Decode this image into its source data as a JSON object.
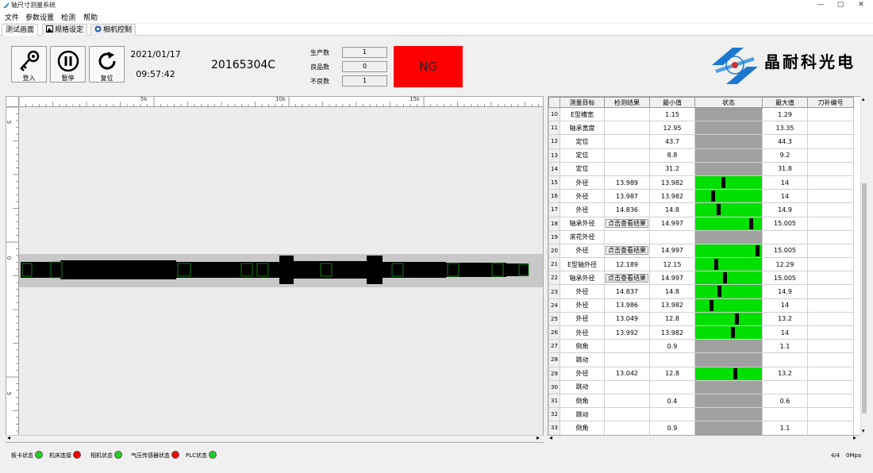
{
  "app": {
    "title": "轴尺寸测量系统",
    "window_buttons": {
      "minimize": "—",
      "maximize": "▢",
      "close": "✕"
    }
  },
  "menu": [
    "文件",
    "参数设置",
    "检测",
    "帮助"
  ],
  "tabs": [
    {
      "label": "测试画面",
      "active": true
    },
    {
      "label": "规格设定",
      "active": false,
      "icon": "image-icon"
    },
    {
      "label": "相机控制",
      "active": false,
      "icon": "camera-icon"
    }
  ],
  "toolbar": {
    "login_label": "登入",
    "pause_label": "暂停",
    "reset_label": "复位",
    "date": "2021/01/17",
    "time": "09:57:42",
    "part_code": "20165304C",
    "counters": [
      {
        "label": "生产数",
        "value": "1"
      },
      {
        "label": "良品数",
        "value": "0"
      },
      {
        "label": "不良数",
        "value": "1"
      }
    ],
    "result": "NG",
    "result_color": "#ff0000",
    "brand": "晶耐科光电"
  },
  "ruler": {
    "h_labels": [
      "5k",
      "10k",
      "15k"
    ],
    "v_labels": [
      "5",
      "0",
      "5"
    ]
  },
  "table": {
    "headers": [
      "测量目标",
      "检测结果",
      "最小值",
      "状态",
      "最大值",
      "刀补编号"
    ],
    "rows": [
      {
        "idx": "10",
        "target": "E型槽宽",
        "result": "",
        "min": "1.15",
        "status": "gray",
        "max": "1.29"
      },
      {
        "idx": "11",
        "target": "轴承宽度",
        "result": "",
        "min": "12.95",
        "status": "gray",
        "max": "13.35"
      },
      {
        "idx": "12",
        "target": "定位",
        "result": "",
        "min": "43.7",
        "status": "gray",
        "max": "44.3"
      },
      {
        "idx": "13",
        "target": "定位",
        "result": "",
        "min": "8.8",
        "status": "gray",
        "max": "9.2"
      },
      {
        "idx": "14",
        "target": "定位",
        "result": "",
        "min": "31.2",
        "status": "gray",
        "max": "31.8"
      },
      {
        "idx": "15",
        "target": "外径",
        "result": "13.989",
        "min": "13.982",
        "status": "green",
        "marker": 0.41,
        "max": "14"
      },
      {
        "idx": "16",
        "target": "外径",
        "result": "13.987",
        "min": "13.982",
        "status": "green",
        "marker": 0.25,
        "max": "14"
      },
      {
        "idx": "17",
        "target": "外径",
        "result": "14.836",
        "min": "14.8",
        "status": "green",
        "marker": 0.34,
        "max": "14.9"
      },
      {
        "idx": "18",
        "target": "轴承外径",
        "result": "点击查看结果",
        "result_button": true,
        "min": "14.997",
        "status": "green",
        "marker": 0.85,
        "max": "15.005"
      },
      {
        "idx": "19",
        "target": "滚花外径",
        "result": "",
        "min": "",
        "status": "gray",
        "max": ""
      },
      {
        "idx": "20",
        "target": "外径",
        "result": "点击查看结果",
        "result_button": true,
        "min": "14.997",
        "status": "green",
        "marker": 0.95,
        "max": "15.005"
      },
      {
        "idx": "21",
        "target": "E型轴外径",
        "result": "12.189",
        "min": "12.15",
        "status": "green",
        "marker": 0.3,
        "max": "12.29"
      },
      {
        "idx": "22",
        "target": "轴承外径",
        "result": "点击查看结果",
        "result_button": true,
        "min": "14.997",
        "status": "green",
        "marker": 0.44,
        "max": "15.005"
      },
      {
        "idx": "23",
        "target": "外径",
        "result": "14.837",
        "min": "14.8",
        "status": "green",
        "marker": 0.35,
        "max": "14.9"
      },
      {
        "idx": "24",
        "target": "外径",
        "result": "13.986",
        "min": "13.982",
        "status": "green",
        "marker": 0.22,
        "max": "14"
      },
      {
        "idx": "25",
        "target": "外径",
        "result": "13.049",
        "min": "12.8",
        "status": "green",
        "marker": 0.62,
        "max": "13.2"
      },
      {
        "idx": "26",
        "target": "外径",
        "result": "13.992",
        "min": "13.982",
        "status": "green",
        "marker": 0.56,
        "max": "14"
      },
      {
        "idx": "27",
        "target": "倒角",
        "result": "",
        "min": "0.9",
        "status": "gray",
        "max": "1.1"
      },
      {
        "idx": "28",
        "target": "跳动",
        "result": "",
        "min": "",
        "status": "gray",
        "max": ""
      },
      {
        "idx": "29",
        "target": "外径",
        "result": "13.042",
        "min": "12.8",
        "status": "green",
        "marker": 0.6,
        "max": "13.2"
      },
      {
        "idx": "30",
        "target": "跳动",
        "result": "",
        "min": "",
        "status": "gray",
        "max": ""
      },
      {
        "idx": "31",
        "target": "倒角",
        "result": "",
        "min": "0.4",
        "status": "gray",
        "max": "0.6"
      },
      {
        "idx": "32",
        "target": "跳动",
        "result": "",
        "min": "",
        "status": "gray",
        "max": ""
      },
      {
        "idx": "33",
        "target": "倒角",
        "result": "",
        "min": "0.9",
        "status": "gray",
        "max": "1.1"
      }
    ]
  },
  "status_bar": {
    "items": [
      {
        "label": "板卡状态",
        "color": "#20d020"
      },
      {
        "label": "机床连接",
        "color": "#ff0000"
      },
      {
        "label": "相机状态",
        "color": "#20d020"
      },
      {
        "label": "气压传感器状态",
        "color": "#ff0000"
      },
      {
        "label": "PLC状态",
        "color": "#20d020"
      }
    ],
    "page": "4/4",
    "pressure": "0Mpa"
  }
}
